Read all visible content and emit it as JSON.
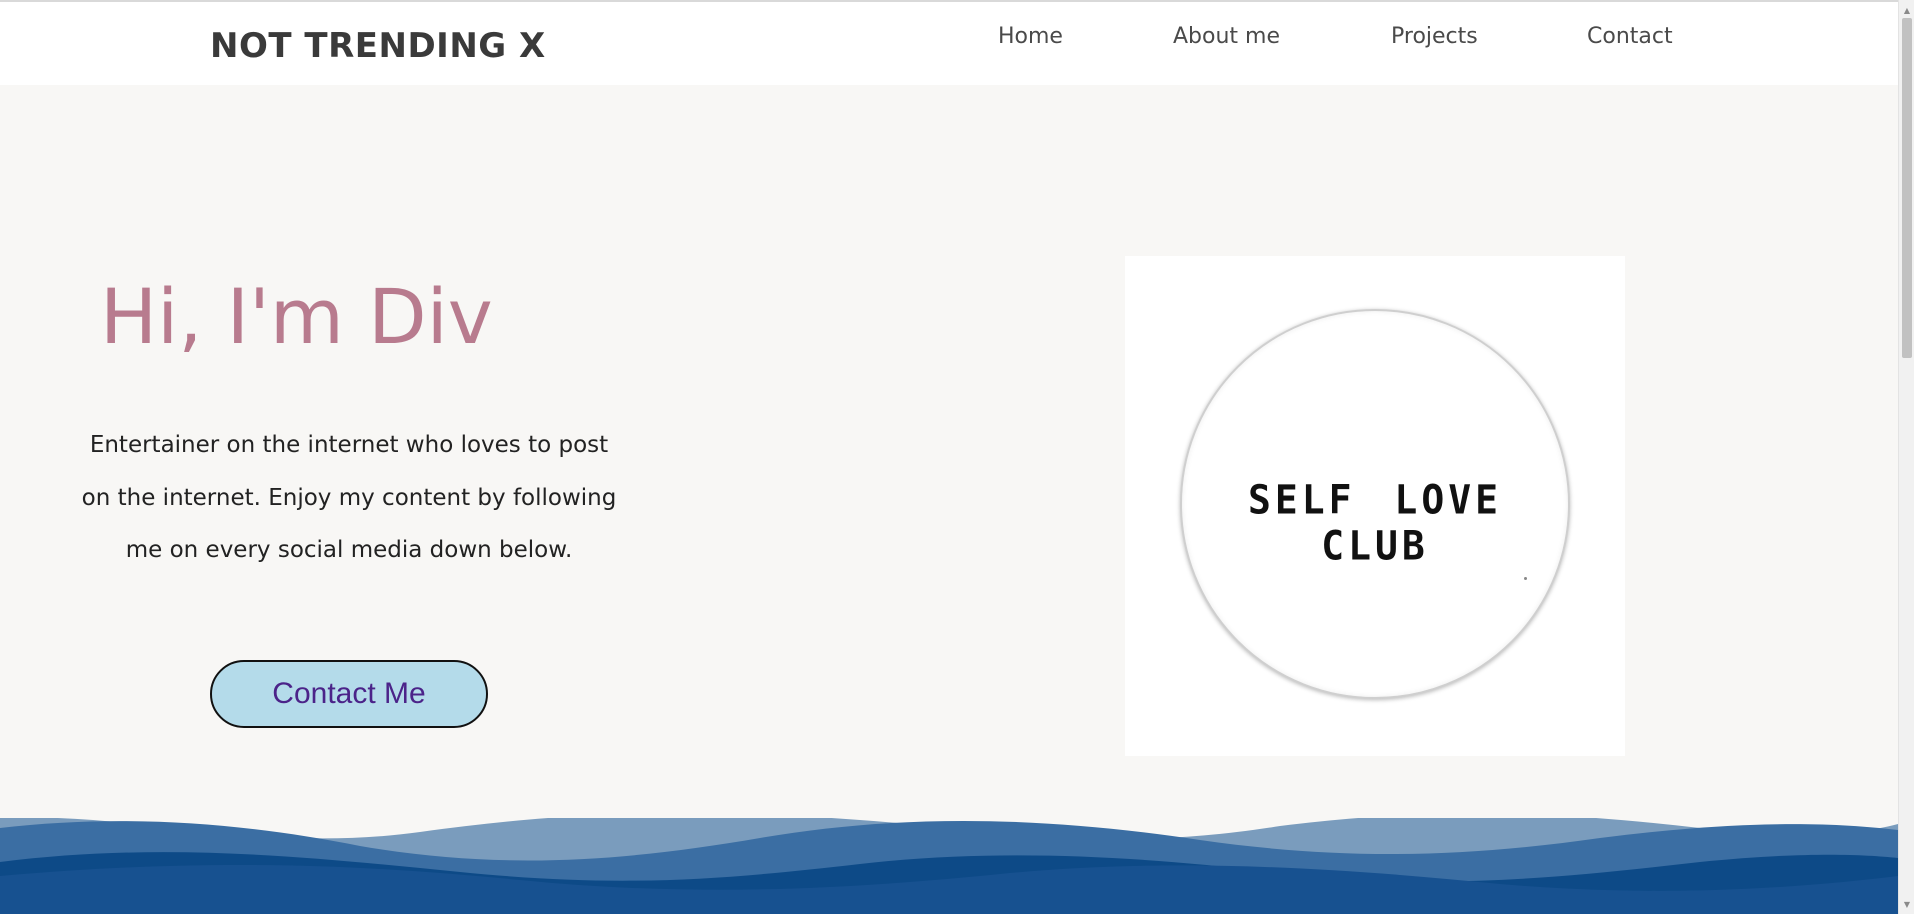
{
  "header": {
    "logo": "NOT TRENDING X",
    "nav": [
      "Home",
      "About me",
      "Projects",
      "Contact"
    ]
  },
  "hero": {
    "title": "Hi, I'm Div",
    "description": "Entertainer on the internet who loves to post on the internet. Enjoy my content by following me on every social media down below.",
    "button_label": "Contact Me"
  },
  "image": {
    "badge_text": "SELF LOVE CLUB"
  },
  "colors": {
    "title_color": "#b87b8e",
    "button_bg": "#b4dbea",
    "button_text": "#4b2389",
    "wave_dark": "#0d4a87",
    "wave_light": "#7a9cbd"
  },
  "icons": {
    "scroll_up": "chevron-up-icon",
    "scroll_down": "chevron-down-icon"
  }
}
